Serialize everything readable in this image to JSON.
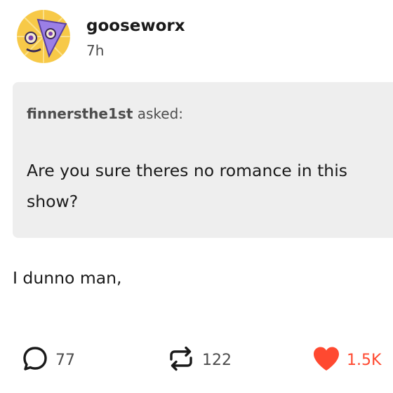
{
  "post": {
    "username": "gooseworx",
    "time": "7h",
    "ask": {
      "asker": "finnersthe1st",
      "asked_label": "asked:",
      "question": "Are you sure theres no romance in this show?"
    },
    "answer": "I dunno man,",
    "notes": {
      "replies": "77",
      "reblogs": "122",
      "likes": "1.5K"
    }
  },
  "colors": {
    "ask_background": "#eeeeee",
    "like_red": "#ff4930",
    "avatar_yellow": "#f7c948",
    "avatar_purple": "#9b7fe6"
  },
  "icons": [
    "avatar",
    "reply-icon",
    "reblog-icon",
    "heart-icon"
  ]
}
